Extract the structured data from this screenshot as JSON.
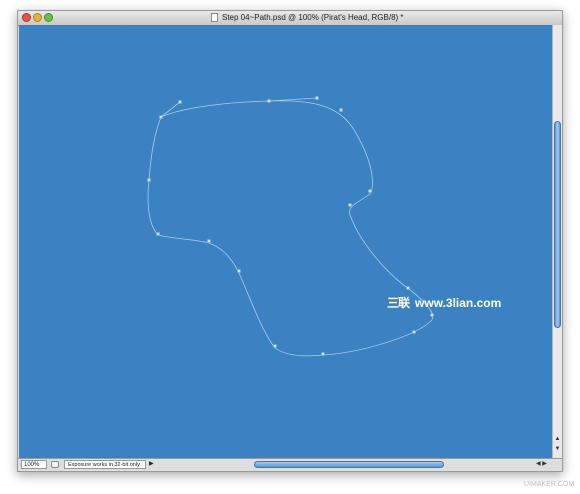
{
  "window": {
    "title": "Step 04~Path.psd @ 100% (Pirat's Head, RGB/8) *"
  },
  "colors": {
    "canvas": "#3a82c2",
    "path_stroke": "#a8cdef",
    "scroll_thumb": "#5b95d6"
  },
  "canvas": {
    "watermark_logo": "三联",
    "watermark_text": "www.3lian.com"
  },
  "statusbar": {
    "zoom": "100%",
    "info": "Exposure works in 32-bit only",
    "menu_arrow": "▶"
  },
  "scrollbar": {
    "up_arrow": "▲",
    "down_arrow": "▼",
    "h_arrows": "◀ ▶"
  },
  "credit": "UIMAKER.COM"
}
